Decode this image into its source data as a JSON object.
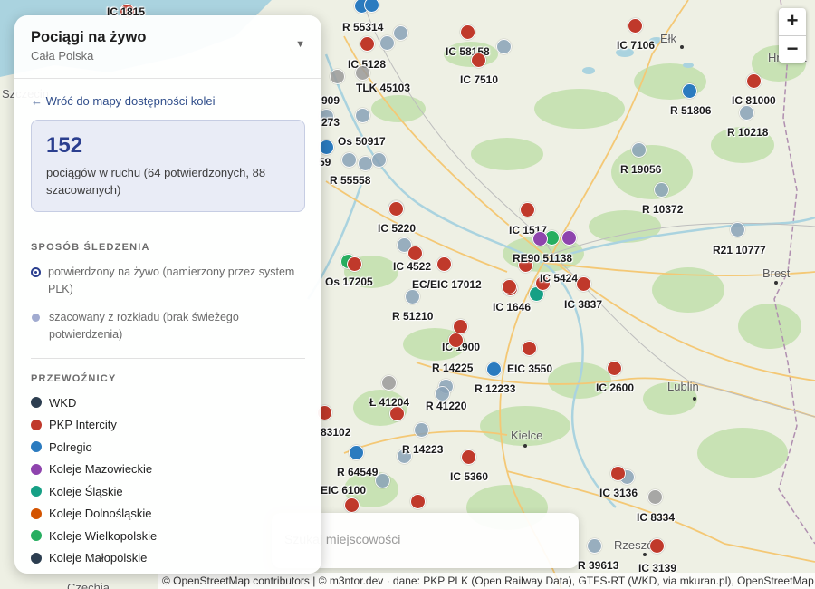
{
  "colors": {
    "pkp_intercity": "#c0392b",
    "polregio": "#2b7bbf",
    "koleje_mazowieckie": "#8e44ad",
    "koleje_slaskie": "#16a085",
    "koleje_dolnoslaskie": "#d35400",
    "koleje_wielkopolskie": "#27ae60",
    "koleje_malopolskie": "#2c3e50",
    "wkd": "#2c3e50",
    "estimated": "#8aa3b8",
    "estimated_grey": "#9b9b9b",
    "accent": "#2b3f8f"
  },
  "panel": {
    "title": "Pociągi na żywo",
    "subtitle": "Cała Polska",
    "collapse_icon": "triangle-down-icon",
    "back_link": "← Wróć do mapy dostępności kolei",
    "stats": {
      "count": "152",
      "description": "pociągów w ruchu (64 potwierdzonych, 88 szacowanych)"
    },
    "tracking": {
      "title": "SPOSÓB ŚLEDZENIA",
      "items": [
        {
          "label": "potwierdzony na żywo (namierzony przez system PLK)"
        },
        {
          "label": "szacowany z rozkładu (brak świeżego potwierdzenia)"
        }
      ]
    },
    "carriers": {
      "title": "PRZEWOŹNICY",
      "items": [
        {
          "label": "WKD",
          "color": "#2c3e50"
        },
        {
          "label": "PKP Intercity",
          "color": "#c0392b"
        },
        {
          "label": "Polregio",
          "color": "#2b7bbf"
        },
        {
          "label": "Koleje Mazowieckie",
          "color": "#8e44ad"
        },
        {
          "label": "Koleje Śląskie",
          "color": "#16a085"
        },
        {
          "label": "Koleje Dolnośląskie",
          "color": "#d35400"
        },
        {
          "label": "Koleje Wielkopolskie",
          "color": "#27ae60"
        },
        {
          "label": "Koleje Małopolskie",
          "color": "#2c3e50"
        }
      ]
    }
  },
  "search": {
    "placeholder": "Szukaj miejscowości"
  },
  "zoom": {
    "in": "+",
    "out": "−"
  },
  "attribution": "© OpenStreetMap contributors | © m3ntor.dev · dane: PKP PLK (Open Railway Data), GTFS-RT (WKD, via mkuran.pl), OpenStreetMap",
  "places": [
    "Ełk",
    "Hrodna",
    "Brest",
    "Lublin",
    "Kielce",
    "Rzeszów",
    "Szczecin",
    "Czechia"
  ],
  "trains": [
    {
      "label": "IC 1815",
      "carrier": "pkp_intercity",
      "status": "confirmed"
    },
    {
      "label": "R 55314",
      "carrier": "polregio",
      "status": "confirmed"
    },
    {
      "label": "IC 58158",
      "carrier": "pkp_intercity",
      "status": "confirmed"
    },
    {
      "label": "IC 7106",
      "carrier": "pkp_intercity",
      "status": "confirmed"
    },
    {
      "label": "IC 5128",
      "carrier": "pkp_intercity",
      "status": "confirmed"
    },
    {
      "label": "IC 7510",
      "carrier": "pkp_intercity",
      "status": "confirmed"
    },
    {
      "label": "TLK 45103",
      "carrier": "pkp_intercity",
      "status": "estimated"
    },
    {
      "label": "IC 81000",
      "carrier": "pkp_intercity",
      "status": "confirmed"
    },
    {
      "label": "909",
      "carrier": "pkp_intercity",
      "status": "estimated"
    },
    {
      "label": "R 51806",
      "carrier": "polregio",
      "status": "confirmed"
    },
    {
      "label": "273",
      "carrier": "polregio",
      "status": "estimated"
    },
    {
      "label": "R 10218",
      "carrier": "polregio",
      "status": "estimated"
    },
    {
      "label": "Os 50917",
      "carrier": "polregio",
      "status": "estimated"
    },
    {
      "label": "59",
      "carrier": "polregio",
      "status": "confirmed"
    },
    {
      "label": "R 19056",
      "carrier": "polregio",
      "status": "estimated"
    },
    {
      "label": "R 55558",
      "carrier": "polregio",
      "status": "estimated"
    },
    {
      "label": "R 10372",
      "carrier": "polregio",
      "status": "estimated"
    },
    {
      "label": "IC 5220",
      "carrier": "pkp_intercity",
      "status": "confirmed"
    },
    {
      "label": "IC 1517",
      "carrier": "pkp_intercity",
      "status": "confirmed"
    },
    {
      "label": "R21 10777",
      "carrier": "koleje_mazowieckie",
      "status": "estimated"
    },
    {
      "label": "IC 4522",
      "carrier": "pkp_intercity",
      "status": "confirmed"
    },
    {
      "label": "RE90 51138",
      "carrier": "koleje_mazowieckie",
      "status": "confirmed"
    },
    {
      "label": "IC 5424",
      "carrier": "pkp_intercity",
      "status": "confirmed"
    },
    {
      "label": "Os 17205",
      "carrier": "pkp_intercity",
      "status": "confirmed"
    },
    {
      "label": "EC/EIC 17012",
      "carrier": "pkp_intercity",
      "status": "confirmed"
    },
    {
      "label": "IC 1646",
      "carrier": "pkp_intercity",
      "status": "confirmed"
    },
    {
      "label": "IC 3837",
      "carrier": "pkp_intercity",
      "status": "confirmed"
    },
    {
      "label": "R 51210",
      "carrier": "polregio",
      "status": "estimated"
    },
    {
      "label": "IC 1900",
      "carrier": "pkp_intercity",
      "status": "confirmed"
    },
    {
      "label": "R 14225",
      "carrier": "pkp_intercity",
      "status": "confirmed"
    },
    {
      "label": "EIC 3550",
      "carrier": "pkp_intercity",
      "status": "confirmed"
    },
    {
      "label": "R 12233",
      "carrier": "polregio",
      "status": "confirmed"
    },
    {
      "label": "IC 2600",
      "carrier": "pkp_intercity",
      "status": "confirmed"
    },
    {
      "label": "Ł 41204",
      "carrier": "pkp_intercity",
      "status": "estimated"
    },
    {
      "label": "R 41220",
      "carrier": "polregio",
      "status": "estimated"
    },
    {
      "label": "83102",
      "carrier": "pkp_intercity",
      "status": "confirmed"
    },
    {
      "label": "R 14223",
      "carrier": "polregio",
      "status": "estimated"
    },
    {
      "label": "R 64549",
      "carrier": "polregio",
      "status": "confirmed"
    },
    {
      "label": "IC 5360",
      "carrier": "pkp_intercity",
      "status": "confirmed"
    },
    {
      "label": "EIC 6100",
      "carrier": "pkp_intercity",
      "status": "confirmed"
    },
    {
      "label": "IC 3136",
      "carrier": "pkp_intercity",
      "status": "confirmed"
    },
    {
      "label": "IC 8334",
      "carrier": "pkp_intercity",
      "status": "estimated"
    },
    {
      "label": "R 39613",
      "carrier": "polregio",
      "status": "estimated"
    },
    {
      "label": "IC 3139",
      "carrier": "pkp_intercity",
      "status": "confirmed"
    }
  ]
}
